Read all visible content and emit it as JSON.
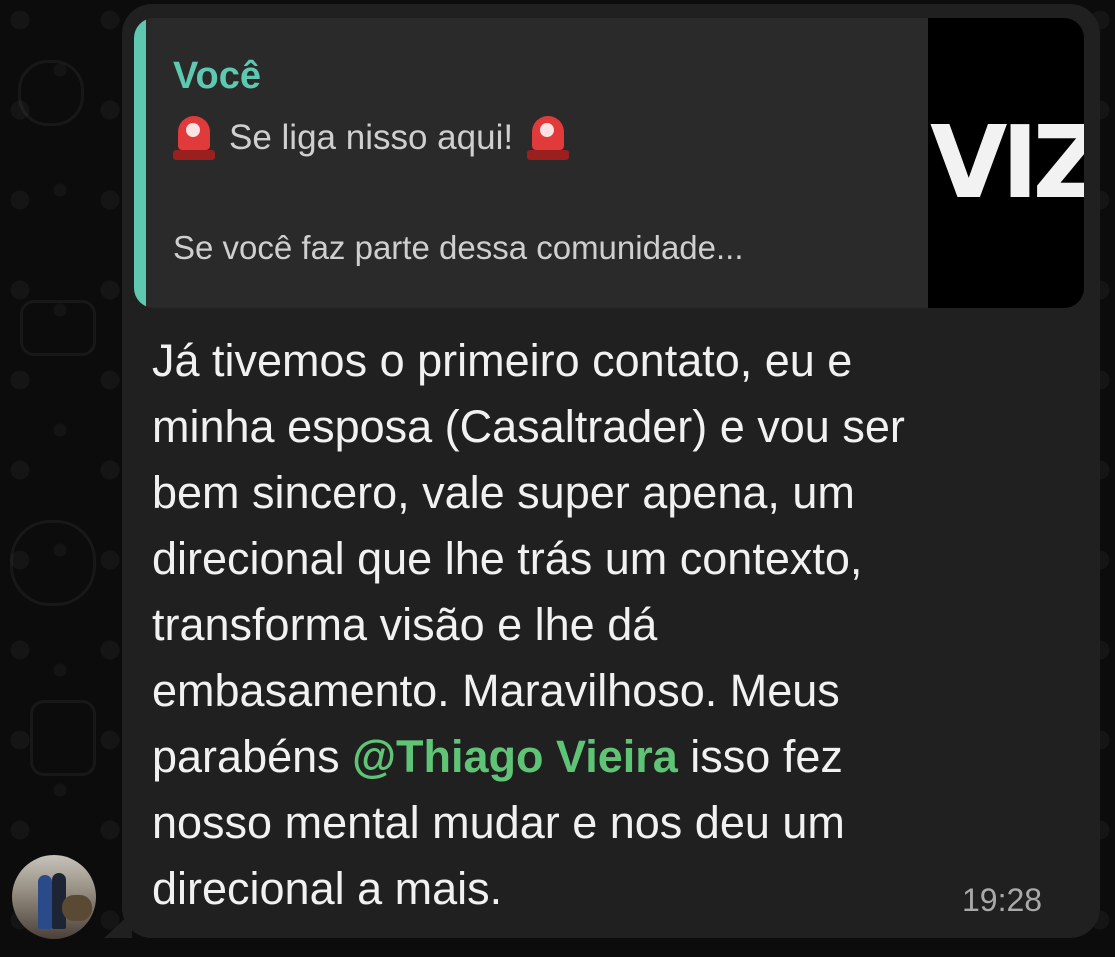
{
  "quote": {
    "sender": "Você",
    "line1": "Se liga nisso aqui!",
    "line2": "Se você faz parte dessa comunidade...",
    "thumbnail_text": "VIZ",
    "accent_color": "#5ec8b0"
  },
  "message": {
    "text_before": "Já tivemos o primeiro contato, eu e\nminha esposa (Casaltrader) e vou ser\nbem sincero, vale super apena, um\ndirecional que lhe trás um contexto,\ntransforma visão e lhe dá\nembasamento. Maravilhoso.  Meus\nparabéns ",
    "mention": "@Thiago Vieira",
    "mention_color": "#5fc476",
    "text_after": " isso fez\nnosso mental mudar e nos deu um\ndirecional a mais.",
    "time": "19:28"
  },
  "icons": {
    "siren": "police-siren-emoji"
  }
}
